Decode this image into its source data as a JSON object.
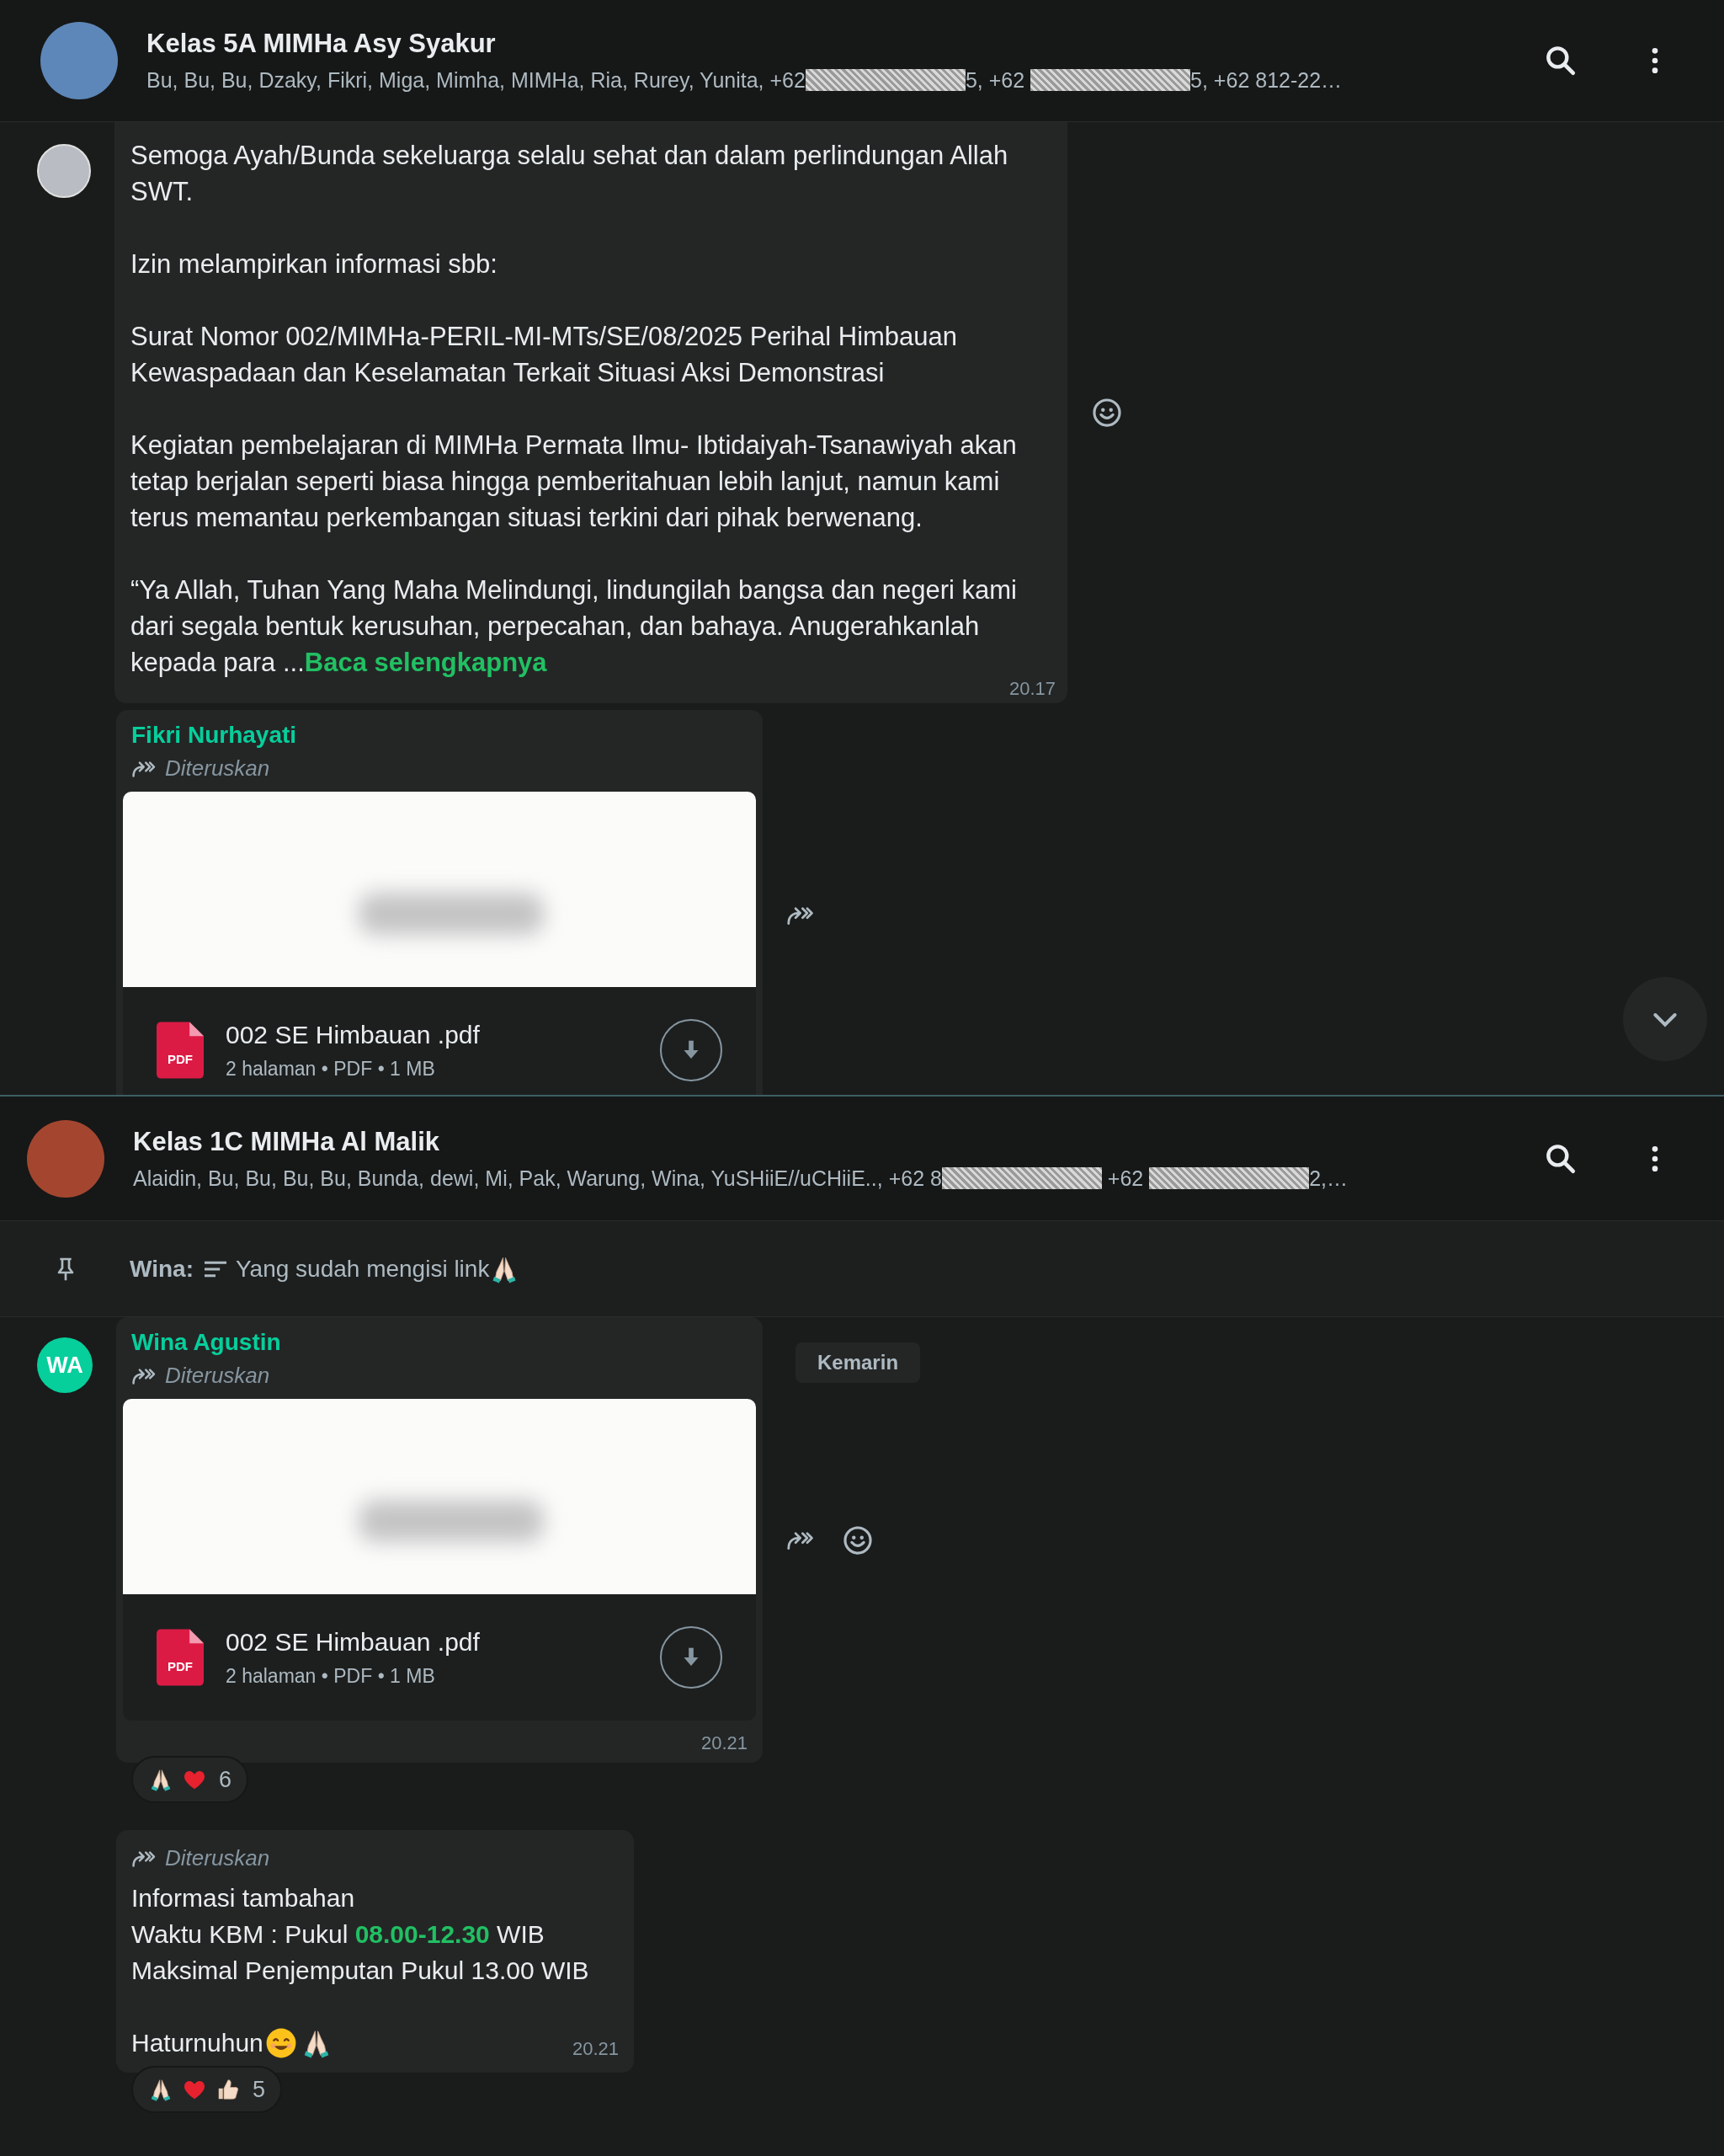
{
  "panes": [
    {
      "title": "Kelas 5A MIMHa Asy Syakur",
      "subtitle": [
        {
          "kind": "text",
          "text": "Bu, Bu, Bu, Dzaky, Fikri, Miga, Mimha, MIMHa, Ria, Rurey, Yunita, +62"
        },
        {
          "kind": "redacted"
        },
        {
          "kind": "text",
          "text": "5, +62 "
        },
        {
          "kind": "redacted"
        },
        {
          "kind": "text",
          "text": "5, +62 812-22…"
        }
      ],
      "messages": [
        {
          "kind": "text",
          "avatar": {
            "kind": "photo"
          },
          "paragraphs": [
            "Semoga Ayah/Bunda sekeluarga selalu sehat dan dalam perlindungan Allah SWT.",
            "Izin melampirkan informasi sbb:",
            "Surat Nomor 002/MIMHa-PERIL-MI-MTs/SE/08/2025 Perihal Himbauan Kewaspadaan dan Keselamatan Terkait Situasi Aksi Demonstrasi",
            "Kegiatan pembelajaran di MIMHa Permata Ilmu- Ibtidaiyah-Tsanawiyah akan tetap berjalan seperti biasa hingga pemberitahuan lebih lanjut, namun kami terus memantau perkembangan situasi terkini dari pihak berwenang.",
            "“Ya Allah, Tuhan Yang Maha Melindungi, lindungilah bangsa dan negeri kami dari segala bentuk kerusuhan, perpecahan, dan bahaya. Anugerahkanlah kepada para ..."
          ],
          "read_more": "Baca selengkapnya",
          "time": "20.17",
          "side_actions": [
            {
              "kind": "emoji"
            }
          ]
        },
        {
          "kind": "document",
          "sender": "Fikri Nurhayati",
          "forwarded": "Diteruskan",
          "file_icon_label": "PDF",
          "file_name": "002 SE Himbauan .pdf",
          "file_meta": "2 halaman • PDF • 1 MB",
          "side_actions": [
            {
              "kind": "forward"
            }
          ]
        }
      ],
      "scroll_down": true
    },
    {
      "title": "Kelas 1C MIMHa Al Malik",
      "subtitle": [
        {
          "kind": "text",
          "text": "Alaidin, Bu, Bu, Bu, Bu, Bunda, dewi, Mi, Pak, Warung, Wina, YuSHiiE//uCHiiE.., +62 8"
        },
        {
          "kind": "redacted"
        },
        {
          "kind": "text",
          "text": " +62 "
        },
        {
          "kind": "redacted"
        },
        {
          "kind": "text",
          "text": "2,…"
        }
      ],
      "pinned": {
        "sender": "Wina:",
        "text": "Yang sudah mengisi link",
        "emojis": [
          {
            "kind": "pray"
          }
        ]
      },
      "date_chip": "Kemarin",
      "messages": [
        {
          "kind": "document",
          "avatar": {
            "kind": "initials",
            "initials": "WA"
          },
          "sender": "Wina Agustin",
          "forwarded": "Diteruskan",
          "file_icon_label": "PDF",
          "file_name": "002 SE Himbauan .pdf",
          "file_meta": "2 halaman • PDF • 1 MB",
          "time": "20.21",
          "side_actions": [
            {
              "kind": "forward"
            },
            {
              "kind": "emoji"
            }
          ],
          "reactions": {
            "emojis": [
              {
                "kind": "pray"
              },
              {
                "kind": "heart"
              }
            ],
            "count": "6"
          }
        },
        {
          "kind": "lines",
          "forwarded": "Diteruskan",
          "lines": [
            [
              {
                "kind": "plain",
                "text": "Informasi tambahan"
              }
            ],
            [
              {
                "kind": "plain",
                "text": "Waktu KBM : Pukul "
              },
              {
                "kind": "highlight",
                "text": "08.00-12.30"
              },
              {
                "kind": "plain",
                "text": " WIB"
              }
            ],
            [
              {
                "kind": "plain",
                "text": "Maksimal Penjemputan Pukul 13.00 WIB"
              }
            ]
          ],
          "closing": {
            "text": "Haturnuhun",
            "emojis": [
              {
                "kind": "smile"
              },
              {
                "kind": "pray"
              }
            ]
          },
          "time": "20.21",
          "reactions": {
            "emojis": [
              {
                "kind": "pray"
              },
              {
                "kind": "heart"
              },
              {
                "kind": "thumbs"
              }
            ],
            "count": "5"
          }
        }
      ]
    }
  ]
}
